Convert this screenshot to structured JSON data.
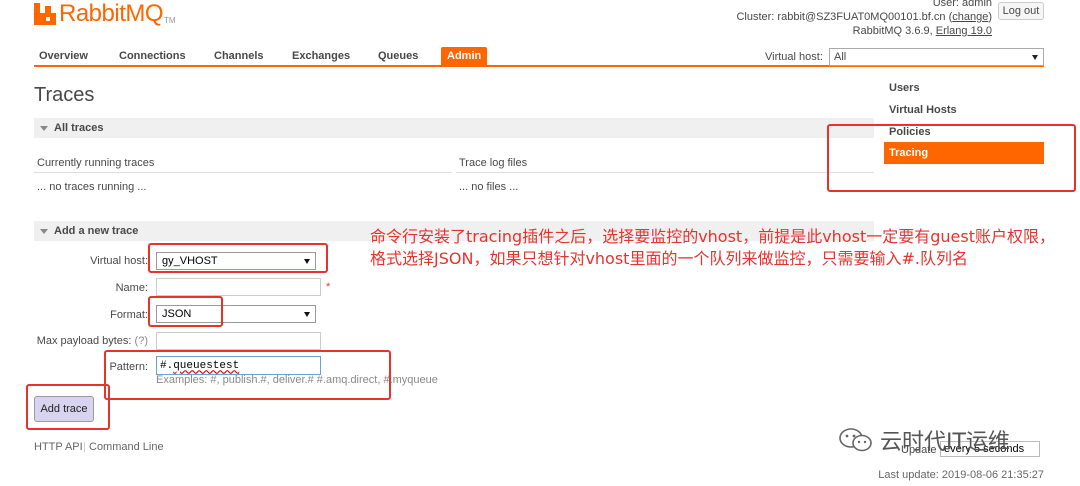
{
  "header": {
    "logo_rabbit": "Rabbit",
    "logo_mq": "MQ",
    "logo_tm": "TM",
    "user_line": "User: admin",
    "cluster_prefix": "Cluster: rabbit@SZ3FUAT0MQ00101.bf.cn (",
    "cluster_change": "change",
    "cluster_suffix": ")",
    "version_prefix": "RabbitMQ 3.6.9, ",
    "erlang_link": "Erlang 19.0",
    "logout_label": "Log out"
  },
  "nav": {
    "tabs": [
      "Overview",
      "Connections",
      "Channels",
      "Exchanges",
      "Queues",
      "Admin"
    ],
    "active": "Admin",
    "vhost_label": "Virtual host:",
    "vhost_value": "All"
  },
  "sidebar": {
    "items": [
      "Users",
      "Virtual Hosts",
      "Policies",
      "Tracing"
    ],
    "active": "Tracing"
  },
  "page": {
    "title": "Traces"
  },
  "all_traces": {
    "heading": "All traces",
    "running_header": "Currently running traces",
    "running_empty": "... no traces running ...",
    "log_header": "Trace log files",
    "log_empty": "... no files ..."
  },
  "add_trace": {
    "heading": "Add a new trace",
    "vhost_label": "Virtual host:",
    "vhost_value": "gy_VHOST",
    "name_label": "Name:",
    "name_value": "",
    "required_mark": "*",
    "format_label": "Format:",
    "format_value": "JSON",
    "max_payload_label": "Max payload bytes:",
    "help_mark": "(?)",
    "max_payload_value": "",
    "pattern_label": "Pattern:",
    "pattern_prefix": "#.",
    "pattern_queue": "queuestest",
    "pattern_examples": "Examples: #, publish.#, deliver.# #.amq.direct, #.myqueue",
    "submit_label": "Add trace"
  },
  "footer": {
    "http_api": "HTTP API",
    "separator": "|",
    "command_line": "Command Line",
    "update_label": "Update",
    "update_value": "every 5 seconds",
    "last_update": "Last update: 2019-08-06 21:35:27"
  },
  "annotation": {
    "text": "命令行安装了tracing插件之后，选择要监控的vhost，前提是此vhost一定要有guest账户权限，格式选择JSON，如果只想针对vhost里面的一个队列来做监控，只需要输入#.队列名"
  },
  "watermark": {
    "text": "云时代IT运维"
  },
  "colors": {
    "brand": "#ff6600",
    "annotation_red": "#e8322e",
    "button_bg": "#d8d4ef"
  }
}
